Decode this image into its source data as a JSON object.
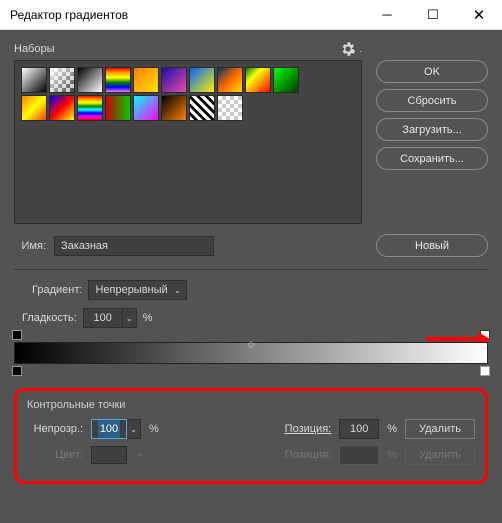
{
  "title": "Редактор градиентов",
  "presets_label": "Наборы",
  "buttons": {
    "ok": "OK",
    "reset": "Сбросить",
    "load": "Загрузить...",
    "save": "Сохранить...",
    "new": "Новый"
  },
  "name": {
    "label": "Имя:",
    "value": "Заказная"
  },
  "gradient_type": {
    "label": "Градиент:",
    "value": "Непрерывный"
  },
  "smoothness": {
    "label": "Гладкость:",
    "value": "100",
    "unit": "%"
  },
  "control_points": {
    "title": "Контрольные точки",
    "opacity_label": "Непрозр.:",
    "opacity_value": "100",
    "unit": "%",
    "position_label": "Позиция:",
    "position_value": "100",
    "delete_label": "Удалить",
    "color_label": "Цвет:"
  }
}
